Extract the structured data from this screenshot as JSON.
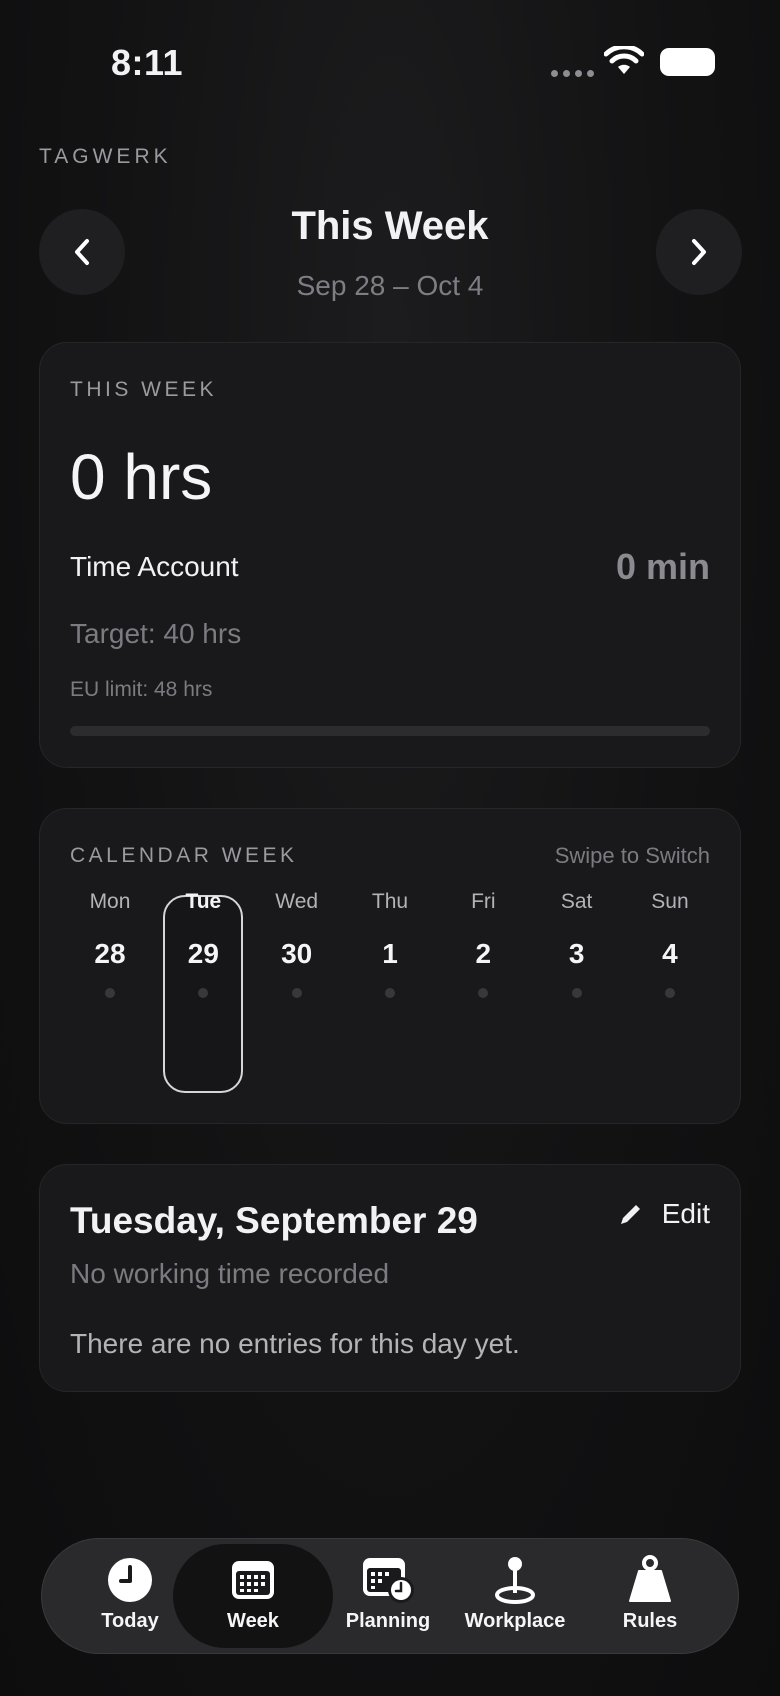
{
  "status_bar": {
    "time": "8:11"
  },
  "app": {
    "brand": "TAGWERK"
  },
  "header": {
    "title": "This Week",
    "range": "Sep 28 – Oct 4"
  },
  "summary": {
    "label": "THIS WEEK",
    "total": "0 hrs",
    "time_account_label": "Time Account",
    "time_account_value": "0 min",
    "target": "Target: 40 hrs",
    "eu_limit": "EU limit: 48 hrs",
    "progress": 0
  },
  "calendar": {
    "label": "CALENDAR WEEK",
    "hint": "Swipe to Switch",
    "selected_index": 1,
    "days": [
      {
        "name": "Mon",
        "date": "28"
      },
      {
        "name": "Tue",
        "date": "29"
      },
      {
        "name": "Wed",
        "date": "30"
      },
      {
        "name": "Thu",
        "date": "1"
      },
      {
        "name": "Fri",
        "date": "2"
      },
      {
        "name": "Sat",
        "date": "3"
      },
      {
        "name": "Sun",
        "date": "4"
      }
    ]
  },
  "day_detail": {
    "title": "Tuesday, September 29",
    "edit_label": "Edit",
    "subtitle": "No working time recorded",
    "empty_message": "There are no entries for this day yet."
  },
  "tabs": [
    {
      "label": "Today",
      "icon": "clock-icon"
    },
    {
      "label": "Week",
      "icon": "calendar-grid-icon",
      "active": true
    },
    {
      "label": "Planning",
      "icon": "calendar-clock-icon"
    },
    {
      "label": "Workplace",
      "icon": "location-pin-icon"
    },
    {
      "label": "Rules",
      "icon": "weight-icon"
    }
  ]
}
